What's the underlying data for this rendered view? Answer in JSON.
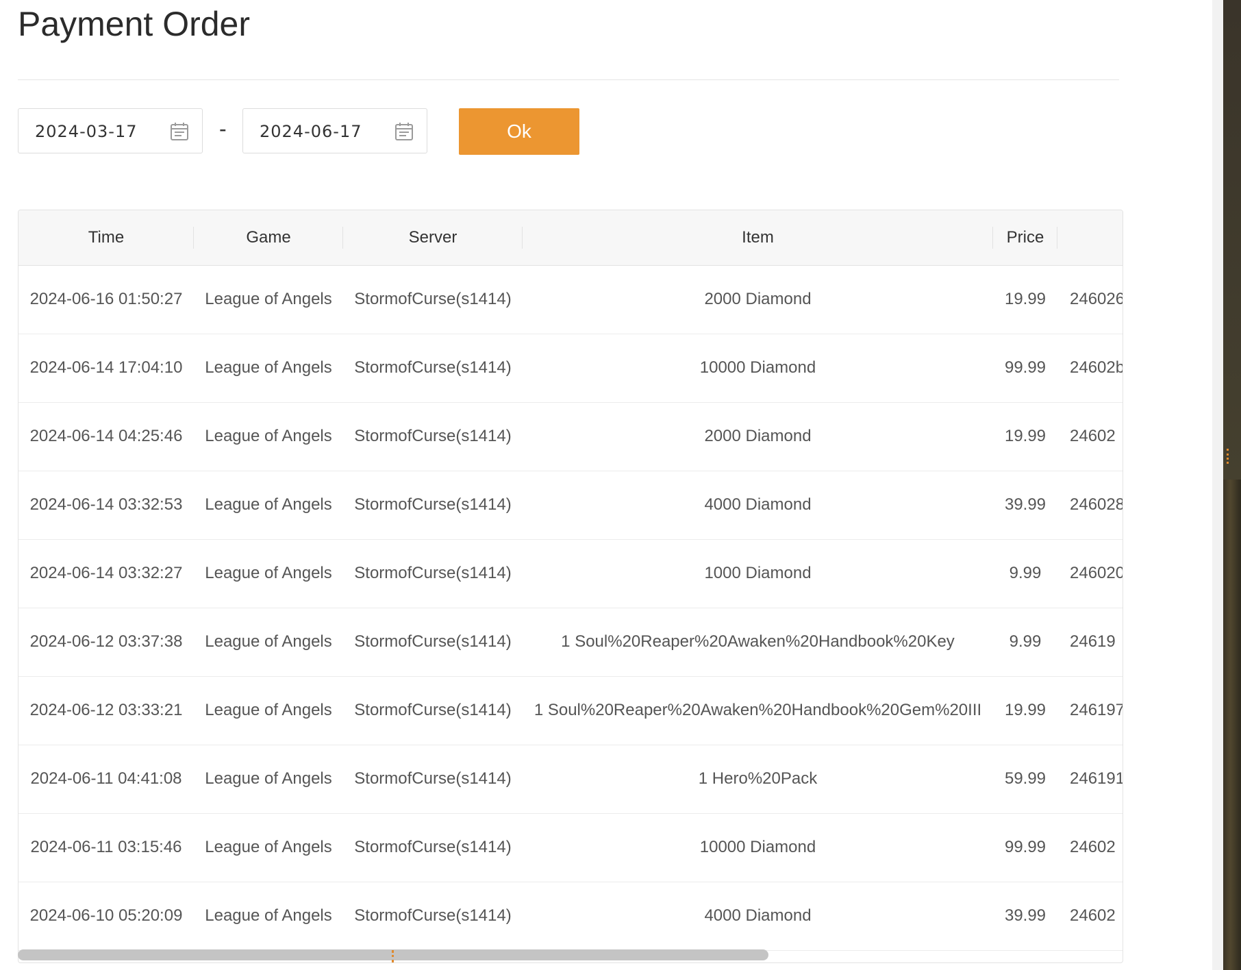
{
  "page": {
    "title": "Payment Order"
  },
  "filter": {
    "start_date": "2024-03-17",
    "end_date": "2024-06-17",
    "separator": "-",
    "ok_label": "Ok",
    "accent_color": "#ec9631"
  },
  "table": {
    "columns": [
      "Time",
      "Game",
      "Server",
      "Item",
      "Price"
    ],
    "rows": [
      {
        "time": "2024-06-16 01:50:27",
        "game": "League of Angels",
        "server": "StormofCurse(s1414)",
        "item": "2000 Diamond",
        "price": "19.99",
        "order": "246026"
      },
      {
        "time": "2024-06-14 17:04:10",
        "game": "League of Angels",
        "server": "StormofCurse(s1414)",
        "item": "10000 Diamond",
        "price": "99.99",
        "order": "24602b"
      },
      {
        "time": "2024-06-14 04:25:46",
        "game": "League of Angels",
        "server": "StormofCurse(s1414)",
        "item": "2000 Diamond",
        "price": "19.99",
        "order": "24602"
      },
      {
        "time": "2024-06-14 03:32:53",
        "game": "League of Angels",
        "server": "StormofCurse(s1414)",
        "item": "4000 Diamond",
        "price": "39.99",
        "order": "246028"
      },
      {
        "time": "2024-06-14 03:32:27",
        "game": "League of Angels",
        "server": "StormofCurse(s1414)",
        "item": "1000 Diamond",
        "price": "9.99",
        "order": "246020"
      },
      {
        "time": "2024-06-12 03:37:38",
        "game": "League of Angels",
        "server": "StormofCurse(s1414)",
        "item": "1 Soul%20Reaper%20Awaken%20Handbook%20Key",
        "price": "9.99",
        "order": "24619"
      },
      {
        "time": "2024-06-12 03:33:21",
        "game": "League of Angels",
        "server": "StormofCurse(s1414)",
        "item": "1 Soul%20Reaper%20Awaken%20Handbook%20Gem%20III",
        "price": "19.99",
        "order": "246197"
      },
      {
        "time": "2024-06-11 04:41:08",
        "game": "League of Angels",
        "server": "StormofCurse(s1414)",
        "item": "1 Hero%20Pack",
        "price": "59.99",
        "order": "246191"
      },
      {
        "time": "2024-06-11 03:15:46",
        "game": "League of Angels",
        "server": "StormofCurse(s1414)",
        "item": "10000 Diamond",
        "price": "99.99",
        "order": "24602"
      },
      {
        "time": "2024-06-10 05:20:09",
        "game": "League of Angels",
        "server": "StormofCurse(s1414)",
        "item": "4000 Diamond",
        "price": "39.99",
        "order": "24602"
      }
    ]
  },
  "scroll": {
    "horizontal_thumb_fraction": 0.68
  },
  "icons": {
    "date_picker": "calendar-icon"
  }
}
